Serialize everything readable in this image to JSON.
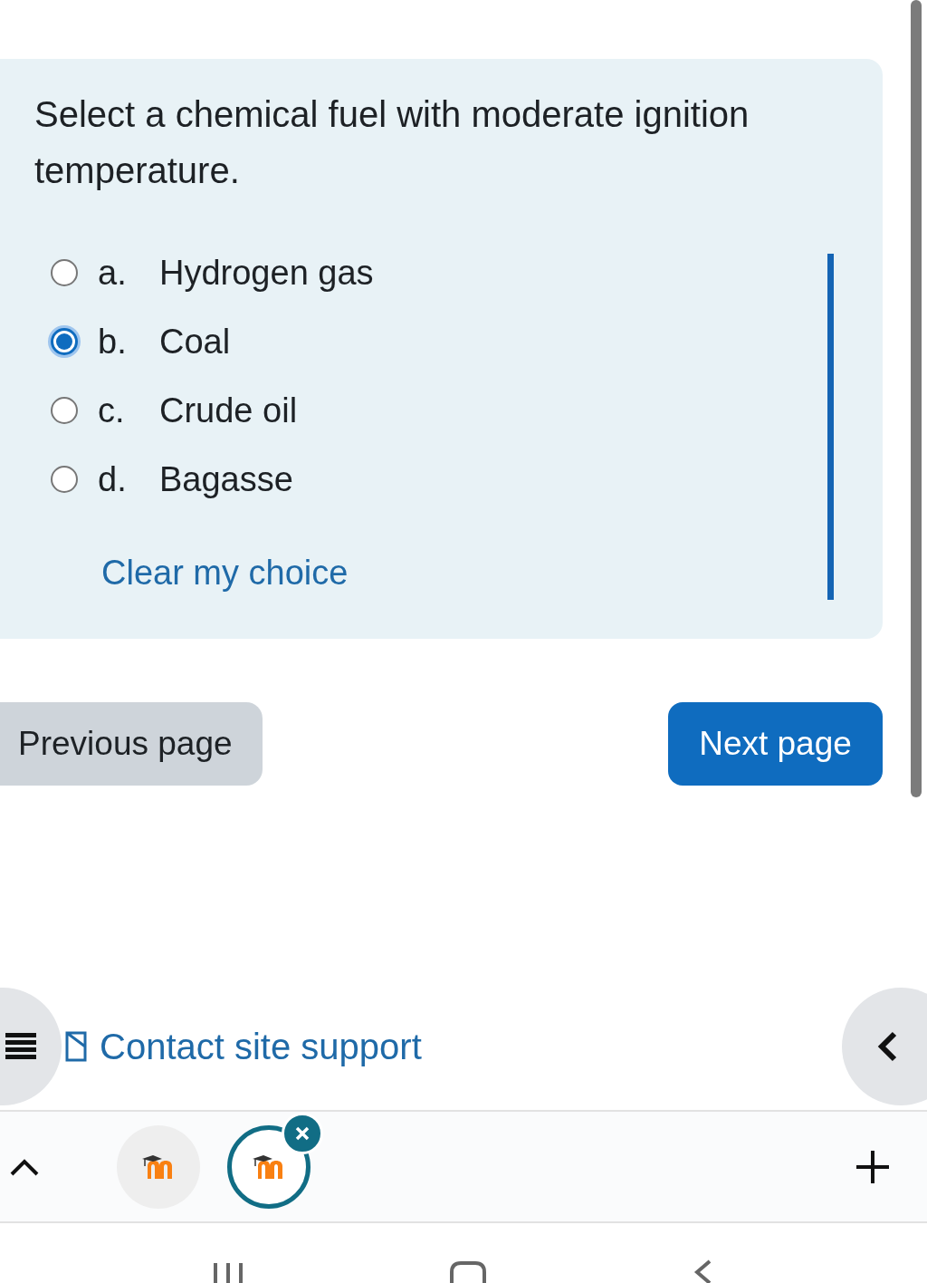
{
  "question": {
    "text": "Select a chemical fuel with moderate ignition temperature.",
    "options": [
      {
        "letter": "a.",
        "label": "Hydrogen gas",
        "selected": false
      },
      {
        "letter": "b.",
        "label": "Coal",
        "selected": true
      },
      {
        "letter": "c.",
        "label": "Crude oil",
        "selected": false
      },
      {
        "letter": "d.",
        "label": "Bagasse",
        "selected": false
      }
    ],
    "clear_link": "Clear my choice"
  },
  "navigation": {
    "previous": "Previous page",
    "next": "Next page"
  },
  "footer": {
    "contact_link": "Contact site support"
  },
  "browser_tabs": [
    {
      "selected": false
    },
    {
      "selected": true
    }
  ]
}
